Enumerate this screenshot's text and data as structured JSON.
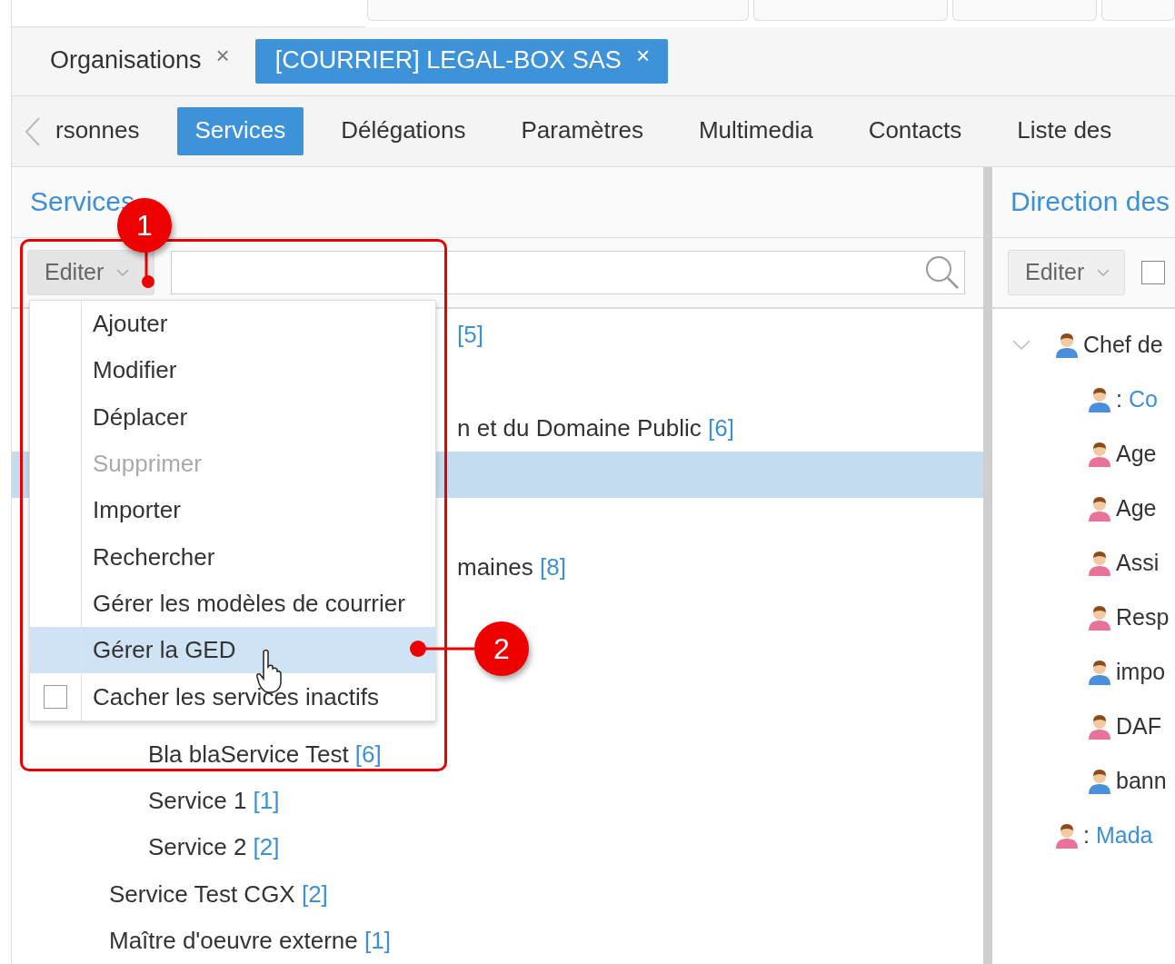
{
  "top_tabs": [
    {
      "label": "Organisations",
      "selected": false
    },
    {
      "label": "[COURRIER] LEGAL-BOX SAS",
      "selected": true
    }
  ],
  "close_glyph": "×",
  "nav": {
    "items": [
      {
        "label": "rsonnes",
        "selected": false
      },
      {
        "label": "Services",
        "selected": true
      },
      {
        "label": "Délégations",
        "selected": false
      },
      {
        "label": "Paramètres",
        "selected": false
      },
      {
        "label": "Multimedia",
        "selected": false
      },
      {
        "label": "Contacts",
        "selected": false
      },
      {
        "label": "Liste des",
        "selected": false
      }
    ]
  },
  "left_panel": {
    "title": "Services",
    "edit_button": "Editer",
    "rows_behind_menu": [
      {
        "count": "[5]",
        "selected": false
      },
      {
        "selected": false
      },
      {
        "label": "n et du Domaine Public",
        "count": "[6]",
        "selected": false
      },
      {
        "selected": true
      },
      {
        "selected": false
      },
      {
        "label": "maines",
        "count": "[8]",
        "selected": false
      },
      {
        "selected": false
      },
      {
        "selected": false
      }
    ],
    "nodes": [
      {
        "children": [
          {
            "label": "Bla blaService Test",
            "count": "[6]"
          },
          {
            "label": "Service 1",
            "count": "[1]"
          },
          {
            "label": "Service 2",
            "count": "[2]"
          }
        ]
      },
      {
        "label": "Service Test CGX",
        "count": "[2]"
      },
      {
        "label": "Maître d'oeuvre externe",
        "count": "[1]"
      }
    ]
  },
  "edit_menu": [
    {
      "kind": "action",
      "label": "Ajouter",
      "disabled": false,
      "selected": false
    },
    {
      "kind": "action",
      "label": "Modifier",
      "disabled": false,
      "selected": false
    },
    {
      "kind": "action",
      "label": "Déplacer",
      "disabled": false,
      "selected": false
    },
    {
      "kind": "action",
      "label": "Supprimer",
      "disabled": true,
      "selected": false
    },
    {
      "kind": "action",
      "label": "Importer",
      "disabled": false,
      "selected": false
    },
    {
      "kind": "action",
      "label": "Rechercher",
      "disabled": false,
      "selected": false
    },
    {
      "kind": "action",
      "label": "Gérer les modèles de courrier",
      "disabled": false,
      "selected": false
    },
    {
      "kind": "action",
      "label": "Gérer la GED",
      "disabled": false,
      "selected": true
    },
    {
      "kind": "checkbox",
      "label": "Cacher les services inactifs",
      "checked": false,
      "selected": false
    }
  ],
  "right_panel": {
    "title": "Direction des",
    "edit_button": "Editer",
    "checkbox": {
      "checked": false
    },
    "nodes": [
      {
        "label": "Chef de",
        "color": "#4a8fdc",
        "expanded": true,
        "children": [
          {
            "prefix": ":",
            "link": "Co",
            "color": "#4a8fdc"
          },
          {
            "label": "Age",
            "color": "#e8729a"
          },
          {
            "label": "Age",
            "color": "#e8729a"
          },
          {
            "label": "Assi",
            "color": "#e8729a"
          },
          {
            "label": "Resp",
            "color": "#e8729a"
          },
          {
            "label": "impo",
            "color": "#4a8fdc"
          },
          {
            "label": "DAF",
            "color": "#e8729a"
          },
          {
            "label": "bann",
            "color": "#4a8fdc"
          }
        ]
      },
      {
        "prefix": ":",
        "link": "Mada",
        "color": "#e8729a"
      }
    ]
  },
  "annotations": [
    {
      "number": "1"
    },
    {
      "number": "2"
    }
  ]
}
